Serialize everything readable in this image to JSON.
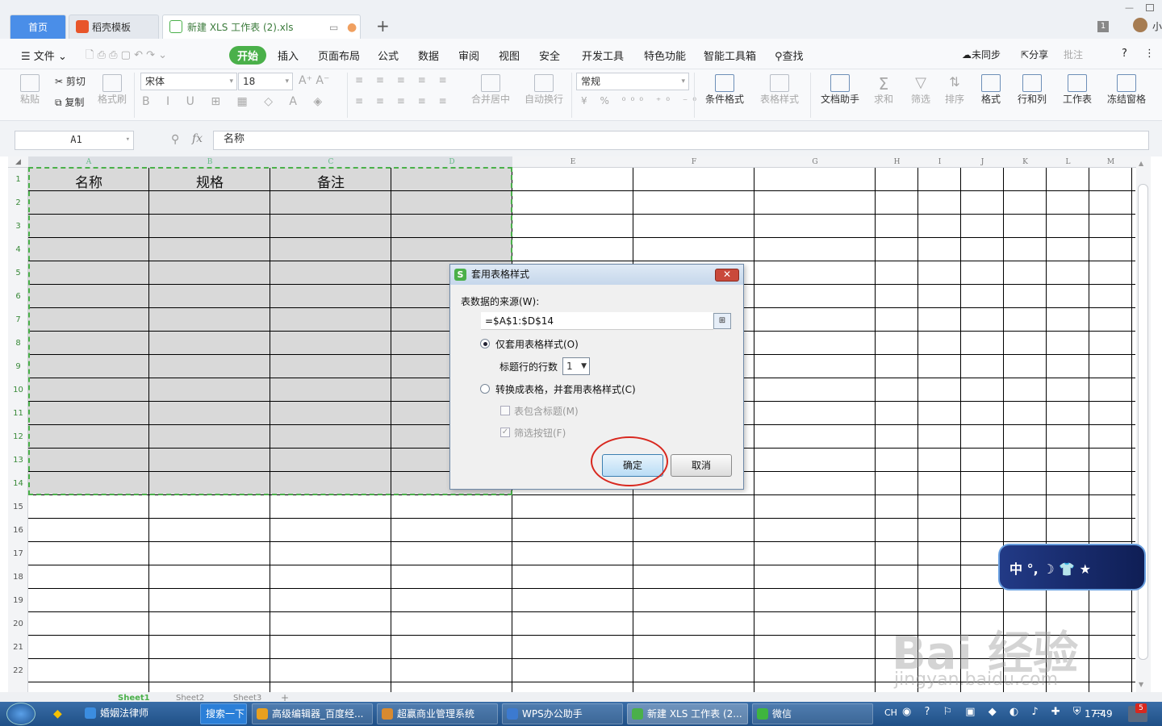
{
  "tabs": {
    "home": "首页",
    "template": "稻壳模板",
    "file": "新建 XLS 工作表 (2).xls",
    "add": "+"
  },
  "menu": {
    "file": "文件",
    "start": "开始",
    "insert": "插入",
    "layout": "页面布局",
    "formula": "公式",
    "data": "数据",
    "review": "审阅",
    "view": "视图",
    "security": "安全",
    "devtools": "开发工具",
    "special": "特色功能",
    "smarttools": "智能工具箱",
    "find": "查找",
    "sync": "未同步",
    "share": "分享",
    "comment": "批注",
    "help": "?"
  },
  "ribbon": {
    "paste": "粘贴",
    "cut": "剪切",
    "copy": "复制",
    "format_painter": "格式刷",
    "font": "宋体",
    "size": "18",
    "number_format": "常规",
    "merge": "合并居中",
    "wrap": "自动换行",
    "cond_format": "条件格式",
    "table_style": "表格样式",
    "doc_helper": "文档助手",
    "sum": "求和",
    "filter": "筛选",
    "sort": "排序",
    "format": "格式",
    "rowcol": "行和列",
    "worksheet": "工作表",
    "freeze": "冻结窗格"
  },
  "formula_bar": {
    "cell_ref": "A1",
    "fx": "fx",
    "content": "名称"
  },
  "columns": [
    "A",
    "B",
    "C",
    "D",
    "E",
    "F",
    "G",
    "H",
    "I",
    "J",
    "K",
    "L",
    "M"
  ],
  "rows": [
    "1",
    "2",
    "3",
    "4",
    "5",
    "6",
    "7",
    "8",
    "9",
    "10",
    "11",
    "12",
    "13",
    "14",
    "15",
    "16",
    "17",
    "18",
    "19",
    "20",
    "21",
    "22"
  ],
  "cells": {
    "A1": "名称",
    "B1": "规格",
    "C1": "备注"
  },
  "dialog": {
    "title": "套用表格样式",
    "source_label": "表数据的来源(W):",
    "source_value": "=$A$1:$D$14",
    "option_style_only": "仅套用表格样式(O)",
    "header_rows_label": "标题行的行数",
    "header_rows_value": "1",
    "option_convert": "转换成表格，并套用表格样式(C)",
    "chk_has_header": "表包含标题(M)",
    "chk_filter": "筛选按钮(F)",
    "ok": "确定",
    "cancel": "取消",
    "close": "✕"
  },
  "sheets": [
    "Sheet1",
    "Sheet2",
    "Sheet3"
  ],
  "taskbar": {
    "ie_label": "婚姻法律师",
    "search_btn": "搜索一下",
    "tasks": [
      "高级编辑器_百度经...",
      "超赢商业管理系统",
      "WPS办公助手",
      "新建 XLS 工作表 (2...",
      "微信"
    ],
    "lang": "CH",
    "clock": "17:49",
    "badge": "5"
  },
  "ime": {
    "label": "中 °, ☽ 👕 ★"
  },
  "watermark": {
    "main": "Bai 经验",
    "url": "jingyan.baidu.com"
  },
  "user_initial": "小",
  "page_num": "1",
  "colors": {
    "accent_green": "#4ab04a",
    "tab_blue": "#4a8ee8",
    "highlight_red": "#d8281f"
  }
}
